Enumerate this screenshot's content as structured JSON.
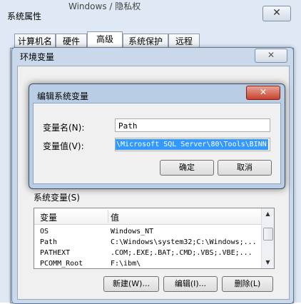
{
  "sysprops": {
    "title": "系统属性",
    "bg_title_fragment": "Windows / 隐私权",
    "close_glyph": "✕",
    "tabs": [
      "计算机名",
      "硬件",
      "高级",
      "系统保护",
      "远程"
    ]
  },
  "envwin": {
    "title": "环境变量",
    "close_glyph": "✕",
    "system_vars_label": "系统变量(S)",
    "columns": [
      "变量",
      "值"
    ],
    "rows": [
      {
        "name": "OS",
        "value": "Windows_NT"
      },
      {
        "name": "Path",
        "value": "C:\\Windows\\system32;C:\\Windows;..."
      },
      {
        "name": "PATHEXT",
        "value": ".COM;.EXE;.BAT;.CMD;.VBS;.VBE;..."
      },
      {
        "name": "PCOMM_Root",
        "value": "F:\\ibm\\"
      }
    ],
    "buttons": {
      "new": "新建(W)...",
      "edit": "编辑(I)...",
      "delete": "删除(L)"
    }
  },
  "editdlg": {
    "title": "编辑系统变量",
    "close_glyph": "✕",
    "name_label": "变量名(N):",
    "value_label": "变量值(V):",
    "name_value": "Path",
    "value_value": ";\\Microsoft SQL Server\\80\\Tools\\BINN",
    "ok": "确定",
    "cancel": "取消"
  },
  "colors": {
    "accent": "#3399ff",
    "close_red": "#c7432d",
    "window_frame": "#b9cde4"
  }
}
